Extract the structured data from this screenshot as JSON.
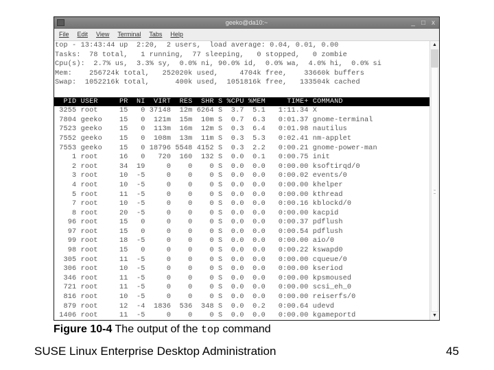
{
  "window": {
    "title": "geeko@da10:~",
    "controls": {
      "minimize": "_",
      "maximize": "□",
      "close": "x"
    },
    "menu": [
      "File",
      "Edit",
      "View",
      "Terminal",
      "Tabs",
      "Help"
    ]
  },
  "summary": [
    "top - 13:43:44 up  2:20,  2 users,  load average: 0.04, 0.01, 0.00",
    "Tasks:  78 total,   1 running,  77 sleeping,   0 stopped,   0 zombie",
    "Cpu(s):  2.7% us,  3.3% sy,  0.0% ni, 90.0% id,  0.0% wa,  4.0% hi,  0.0% si",
    "Mem:    256724k total,   252020k used,     4704k free,    33660k buffers",
    "Swap:  1052216k total,      400k used,  1051816k free,   133504k cached"
  ],
  "columns": [
    "PID",
    "USER",
    "PR",
    "NI",
    "VIRT",
    "RES",
    "SHR",
    "S",
    "%CPU",
    "%MEM",
    "TIME+",
    "COMMAND"
  ],
  "processes": [
    [
      "3255",
      "root",
      "15",
      "0",
      "37148",
      "12m",
      "6264",
      "S",
      "3.7",
      "5.1",
      "1:11.34",
      "X"
    ],
    [
      "7804",
      "geeko",
      "15",
      "0",
      "121m",
      "15m",
      "10m",
      "S",
      "0.7",
      "6.3",
      "0:01.37",
      "gnome-terminal"
    ],
    [
      "7523",
      "geeko",
      "15",
      "0",
      "113m",
      "16m",
      "12m",
      "S",
      "0.3",
      "6.4",
      "0:01.98",
      "nautilus"
    ],
    [
      "7552",
      "geeko",
      "15",
      "0",
      "108m",
      "13m",
      "11m",
      "S",
      "0.3",
      "5.3",
      "0:02.41",
      "nm-applet"
    ],
    [
      "7553",
      "geeko",
      "15",
      "0",
      "18796",
      "5548",
      "4152",
      "S",
      "0.3",
      "2.2",
      "0:00.21",
      "gnome-power-man"
    ],
    [
      "1",
      "root",
      "16",
      "0",
      "720",
      "160",
      "132",
      "S",
      "0.0",
      "0.1",
      "0:00.75",
      "init"
    ],
    [
      "2",
      "root",
      "34",
      "19",
      "0",
      "0",
      "0",
      "S",
      "0.0",
      "0.0",
      "0:00.00",
      "ksoftirqd/0"
    ],
    [
      "3",
      "root",
      "10",
      "-5",
      "0",
      "0",
      "0",
      "S",
      "0.0",
      "0.0",
      "0:00.02",
      "events/0"
    ],
    [
      "4",
      "root",
      "10",
      "-5",
      "0",
      "0",
      "0",
      "S",
      "0.0",
      "0.0",
      "0:00.00",
      "khelper"
    ],
    [
      "5",
      "root",
      "11",
      "-5",
      "0",
      "0",
      "0",
      "S",
      "0.0",
      "0.0",
      "0:00.00",
      "kthread"
    ],
    [
      "7",
      "root",
      "10",
      "-5",
      "0",
      "0",
      "0",
      "S",
      "0.0",
      "0.0",
      "0:00.16",
      "kblockd/0"
    ],
    [
      "8",
      "root",
      "20",
      "-5",
      "0",
      "0",
      "0",
      "S",
      "0.0",
      "0.0",
      "0:00.00",
      "kacpid"
    ],
    [
      "96",
      "root",
      "15",
      "0",
      "0",
      "0",
      "0",
      "S",
      "0.0",
      "0.0",
      "0:00.37",
      "pdflush"
    ],
    [
      "97",
      "root",
      "15",
      "0",
      "0",
      "0",
      "0",
      "S",
      "0.0",
      "0.0",
      "0:00.54",
      "pdflush"
    ],
    [
      "99",
      "root",
      "18",
      "-5",
      "0",
      "0",
      "0",
      "S",
      "0.0",
      "0.0",
      "0:00.00",
      "aio/0"
    ],
    [
      "98",
      "root",
      "15",
      "0",
      "0",
      "0",
      "0",
      "S",
      "0.0",
      "0.0",
      "0:00.22",
      "kswapd0"
    ],
    [
      "305",
      "root",
      "11",
      "-5",
      "0",
      "0",
      "0",
      "S",
      "0.0",
      "0.0",
      "0:00.00",
      "cqueue/0"
    ],
    [
      "306",
      "root",
      "10",
      "-5",
      "0",
      "0",
      "0",
      "S",
      "0.0",
      "0.0",
      "0:00.00",
      "kseriod"
    ],
    [
      "346",
      "root",
      "11",
      "-5",
      "0",
      "0",
      "0",
      "S",
      "0.0",
      "0.0",
      "0:00.00",
      "kpsmoused"
    ],
    [
      "721",
      "root",
      "11",
      "-5",
      "0",
      "0",
      "0",
      "S",
      "0.0",
      "0.0",
      "0:00.00",
      "scsi_eh_0"
    ],
    [
      "816",
      "root",
      "10",
      "-5",
      "0",
      "0",
      "0",
      "S",
      "0.0",
      "0.0",
      "0:00.00",
      "reiserfs/0"
    ],
    [
      "879",
      "root",
      "12",
      "-4",
      "1836",
      "536",
      "348",
      "S",
      "0.0",
      "0.2",
      "0:00.64",
      "udevd"
    ],
    [
      "1406",
      "root",
      "11",
      "-5",
      "0",
      "0",
      "0",
      "S",
      "0.0",
      "0.0",
      "0:00.00",
      "kgameportd"
    ]
  ],
  "caption": {
    "label": "Figure 10-4",
    "text_before": " The output of the ",
    "code": "top",
    "text_after": " command"
  },
  "footer": {
    "course": "SUSE Linux Enterprise Desktop Administration",
    "page": "45"
  }
}
